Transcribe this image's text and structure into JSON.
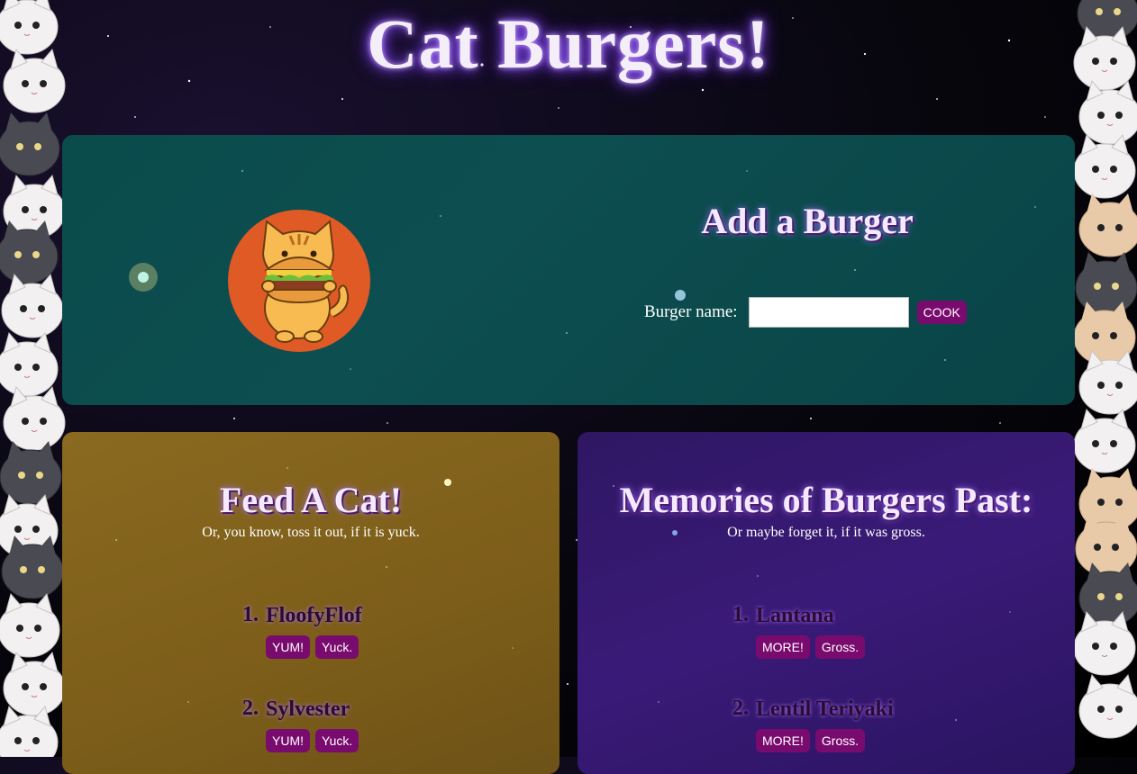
{
  "page": {
    "title": "Cat Burgers!"
  },
  "add_burger": {
    "heading": "Add a Burger",
    "label": "Burger name:",
    "input_value": "",
    "cook_label": "COOK",
    "logo_icon": "cat-eating-burger-icon"
  },
  "feed": {
    "heading": "Feed A Cat!",
    "subtext": "Or, you know, toss it out, if it is yuck.",
    "items": [
      {
        "number": "1.",
        "name": "FloofyFlof",
        "yum_label": "YUM!",
        "yuck_label": "Yuck."
      },
      {
        "number": "2.",
        "name": "Sylvester",
        "yum_label": "YUM!",
        "yuck_label": "Yuck."
      }
    ]
  },
  "memories": {
    "heading": "Memories of Burgers Past:",
    "subtext": "Or maybe forget it, if it was gross.",
    "items": [
      {
        "number": "1.",
        "name": "Lantana",
        "more_label": "MORE!",
        "gross_label": "Gross."
      },
      {
        "number": "2.",
        "name": "Lentil Teriyaki",
        "more_label": "MORE!",
        "gross_label": "Gross."
      }
    ]
  },
  "colors": {
    "button": "#7a0b6e",
    "add_panel": "#0a4b4c",
    "feed_panel": "#7c5d19",
    "memories_panel": "#331a6c"
  }
}
